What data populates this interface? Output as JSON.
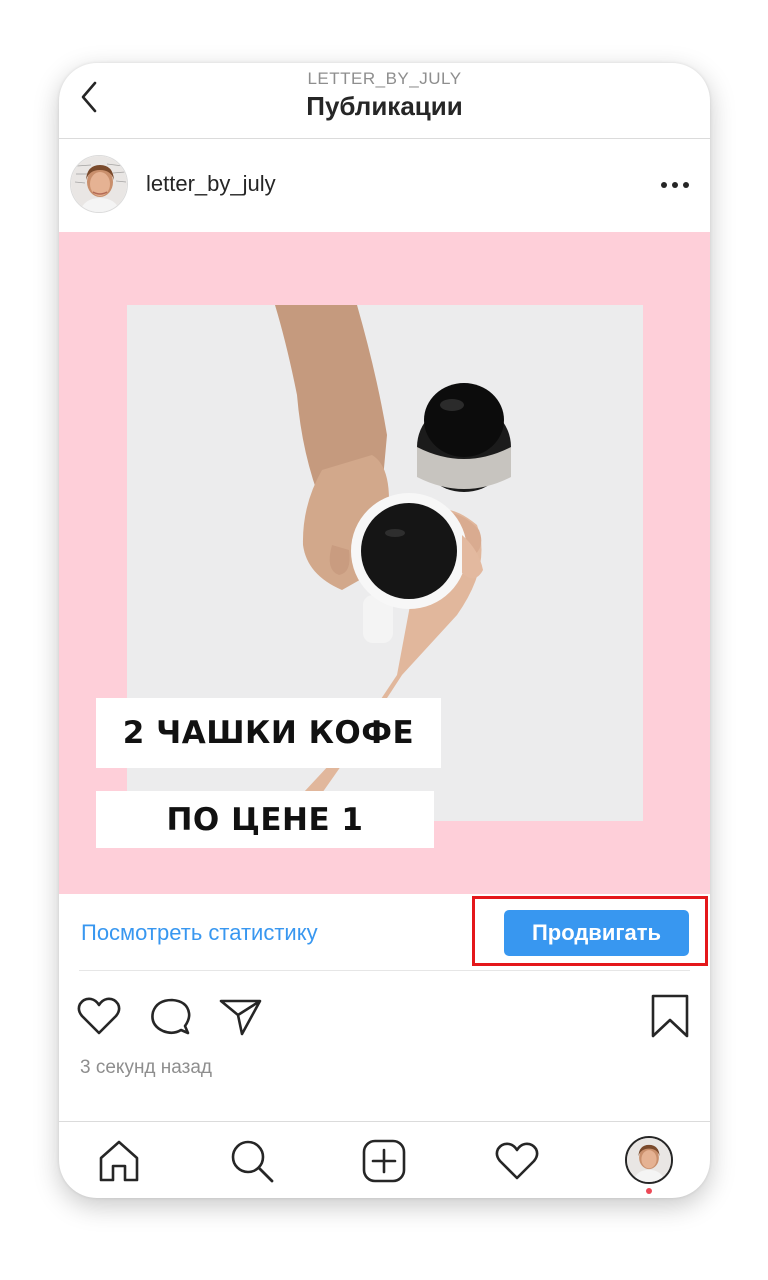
{
  "header": {
    "subtitle": "LETTER_BY_JULY",
    "title": "Публикации",
    "back_icon": "chevron-left-icon"
  },
  "post": {
    "username": "letter_by_july",
    "more_icon": "ellipsis-icon",
    "caption_line1": "2 ЧАШКИ КОФЕ",
    "caption_line2": "ПО ЦЕНЕ 1",
    "image_bg_color": "#fecfd9"
  },
  "stats": {
    "link_label": "Посмотреть статистику",
    "promote_label": "Продвигать",
    "accent_color": "#3897f0",
    "highlight_color": "#e4171b"
  },
  "actions": {
    "icons": [
      "heart-icon",
      "comment-icon",
      "share-icon",
      "bookmark-icon"
    ],
    "timestamp": "3 секунд назад"
  },
  "bottom_nav": {
    "icons": [
      "home-icon",
      "search-icon",
      "add-post-icon",
      "activity-heart-icon",
      "profile-avatar"
    ]
  }
}
